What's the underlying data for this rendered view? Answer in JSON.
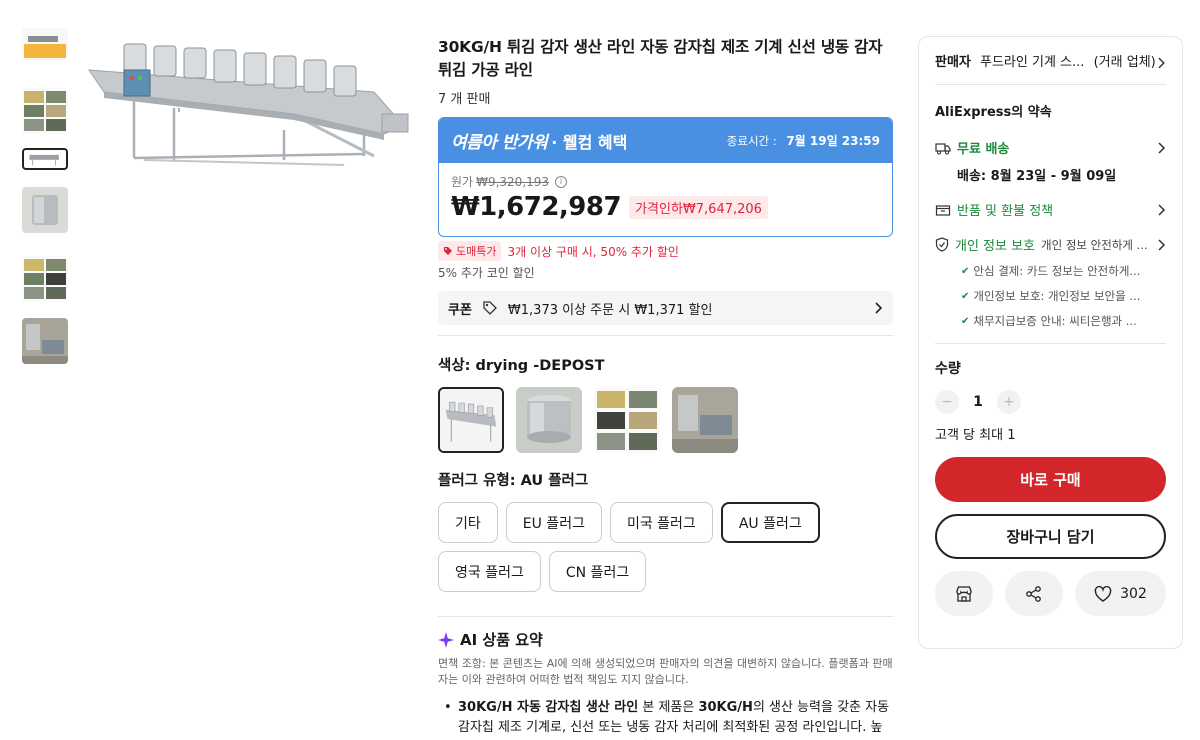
{
  "product": {
    "title": "30KG/H 튀김 감자 생산 라인 자동 감자칩 제조 기계 신선 냉동 감자튀김 가공 라인",
    "sold": "7 개 판매"
  },
  "promo": {
    "brand": "여름아 반가워",
    "suffix": "· 웰컴 혜택",
    "end_label": "종료시간 :",
    "end_value": "7월 19일 23:59",
    "bar_color": "#4a90e2"
  },
  "price": {
    "original_label": "원가",
    "original_value": "₩9,320,193",
    "current": "₩1,672,987",
    "discount": "가격인하₩7,647,206"
  },
  "bulk": {
    "badge": "도매특가",
    "text": "3개 이상 구매 시, 50% 추가 할인",
    "coin": "5% 추가 코인 할인"
  },
  "coupon": {
    "label": "쿠폰",
    "text": "₩1,373 이상 주문 시 ₩1,371 할인"
  },
  "color_option": {
    "title": "색상: drying -DEPOST",
    "swatches": [
      {
        "name": "conveyor",
        "selected": true
      },
      {
        "name": "tank",
        "selected": false
      },
      {
        "name": "collage",
        "selected": false
      },
      {
        "name": "machine",
        "selected": false
      }
    ]
  },
  "plug_option": {
    "title": "플러그 유형: AU 플러그",
    "options": [
      "기타",
      "EU 플러그",
      "미국 플러그",
      "AU 플러그",
      "영국 플러그",
      "CN 플러그"
    ],
    "selected": "AU 플러그"
  },
  "ai_summary": {
    "title": "AI 상품 요약",
    "disclaimer": "면책 조항: 본 콘텐츠는 AI에 의해 생성되었으며 판매자의 의견을 대변하지 않습니다. 플랫폼과 판매자는 이와 관련하여 어떠한 법적 책임도 지지 않습니다.",
    "bullet_bold1": "30KG/H 자동 감자칩 생산 라인",
    "bullet_text1": " 본 제품은 ",
    "bullet_bold2": "30KG/H",
    "bullet_text2": "의 생산 능력을 갖춘 자동 감자칩 제조 기계로, 신선 또는 냉동 감자 처리에 최적화된 공정 라인입니다. 높은 생산성과 안정적인 작동을 제공합니다."
  },
  "seller": {
    "label": "판매자",
    "name": "푸드라인 기계 스...",
    "note": "(거래 업체)"
  },
  "promise": {
    "title": "AliExpress의 약속",
    "shipping": "무료 배송",
    "delivery": "배송: 8월 23일 - 9월 09일",
    "refund": "반품 및 환불 정책",
    "privacy": "개인 정보 보호",
    "privacy_note": "개인 정보 안전하게 ...",
    "checks": [
      "안심 결제: 카드 정보는 안전하게...",
      "개인정보 보호: 개인정보 보안을 ...",
      "채무지급보증 안내: 씨티은행과 ..."
    ],
    "green": "#1c8a3a"
  },
  "quantity": {
    "title": "수량",
    "value": "1",
    "limit": "고객 당 최대 1"
  },
  "actions": {
    "buy": "바로 구매",
    "cart": "장바구니 담기",
    "likes": "302",
    "buy_color": "#d3262b"
  }
}
